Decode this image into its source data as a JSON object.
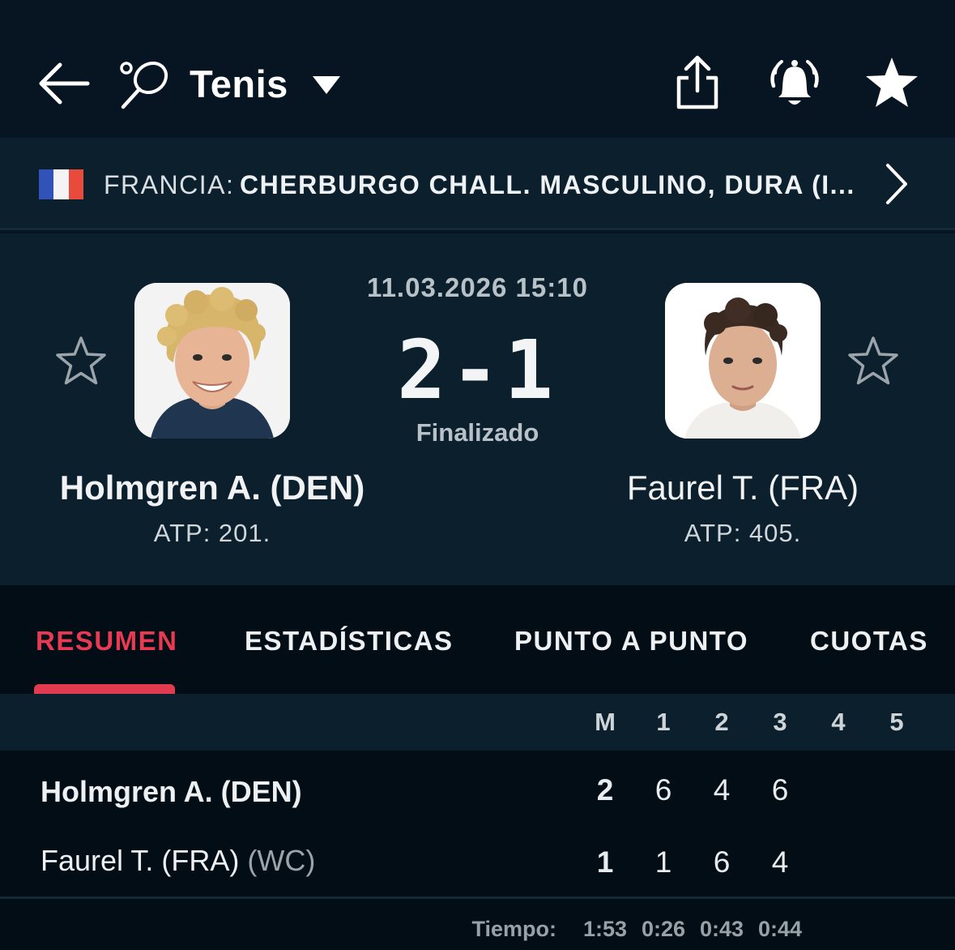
{
  "header": {
    "sport_title": "Tenis",
    "icons": [
      "back-arrow-icon",
      "tennis-racket-icon",
      "caret-down-icon",
      "share-icon",
      "bell-icon",
      "star-filled-icon"
    ]
  },
  "league": {
    "country": "FRANCIA:",
    "name": "CHERBURGO CHALL. MASCULINO, DURA (I...",
    "flag_colors": [
      "#3152b8",
      "#f4f4f4",
      "#e84a3c"
    ]
  },
  "match": {
    "datetime": "11.03.2026 15:10",
    "score": "2-1",
    "status": "Finalizado",
    "home": {
      "name": "Holmgren A. (DEN)",
      "rank": "ATP: 201."
    },
    "away": {
      "name": "Faurel T. (FRA)",
      "rank": "ATP: 405."
    }
  },
  "tabs": [
    "RESUMEN",
    "ESTADÍSTICAS",
    "PUNTO A PUNTO",
    "CUOTAS"
  ],
  "scoreboard": {
    "columns": [
      "M",
      "1",
      "2",
      "3",
      "4",
      "5"
    ],
    "rows": [
      {
        "name": "Holmgren A. (DEN)",
        "tag": "",
        "values": [
          "2",
          "6",
          "4",
          "6"
        ]
      },
      {
        "name": "Faurel T. (FRA)",
        "tag": "(WC)",
        "values": [
          "1",
          "1",
          "6",
          "4"
        ]
      }
    ],
    "time_label": "Tiempo:",
    "times": [
      "1:53",
      "0:26",
      "0:43",
      "0:44"
    ]
  },
  "colors": {
    "accent": "#e83a52",
    "background": "#061521",
    "panel": "#0b1f2c"
  }
}
